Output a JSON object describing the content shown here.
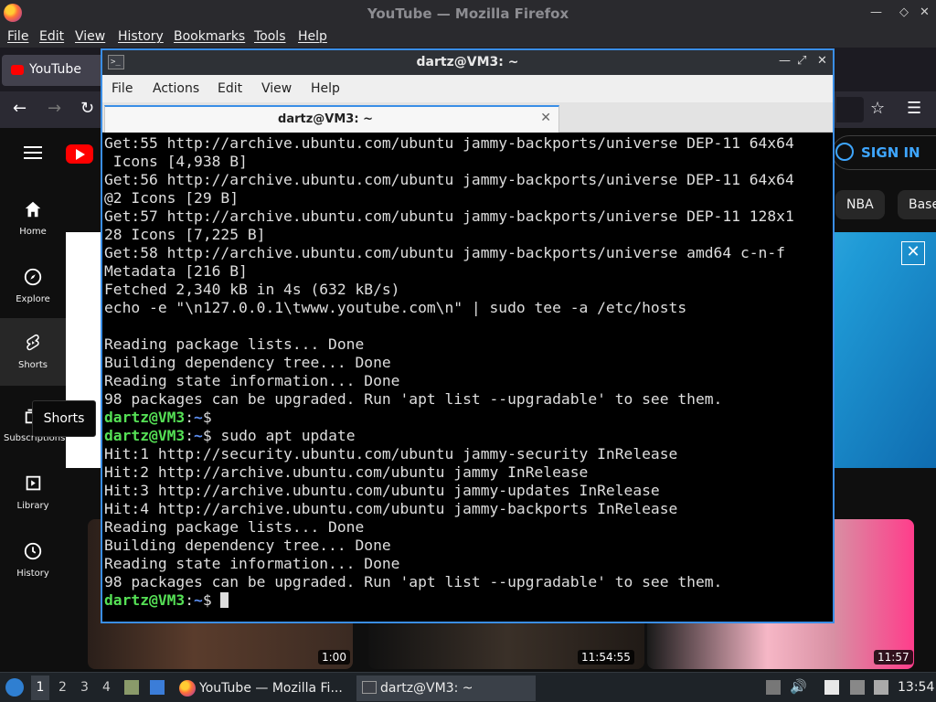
{
  "firefox": {
    "title": "YouTube — Mozilla Firefox",
    "menu": [
      "File",
      "Edit",
      "View",
      "History",
      "Bookmarks",
      "Tools",
      "Help"
    ],
    "tab_label": "YouTube"
  },
  "youtube": {
    "sidebar": [
      {
        "label": "Home",
        "icon": "home-icon"
      },
      {
        "label": "Explore",
        "icon": "compass-icon"
      },
      {
        "label": "Shorts",
        "icon": "shorts-icon"
      },
      {
        "label": "Subscriptions",
        "icon": "subscriptions-icon"
      },
      {
        "label": "Library",
        "icon": "library-icon"
      },
      {
        "label": "History",
        "icon": "history-icon"
      }
    ],
    "tooltip": "Shorts",
    "sign_in": "SIGN IN",
    "chips": [
      "NBA",
      "Base"
    ],
    "banner_close": "✕",
    "durations": [
      "1:00",
      "11:54:55",
      "11:57"
    ]
  },
  "terminal": {
    "window_title": "dartz@VM3: ~",
    "menu": [
      "File",
      "Actions",
      "Edit",
      "View",
      "Help"
    ],
    "tab_title": "dartz@VM3: ~",
    "lines": [
      {
        "text": "Get:55 http://archive.ubuntu.com/ubuntu jammy-backports/universe DEP-11 64x64"
      },
      {
        "text": " Icons [4,938 B]"
      },
      {
        "text": "Get:56 http://archive.ubuntu.com/ubuntu jammy-backports/universe DEP-11 64x64"
      },
      {
        "text": "@2 Icons [29 B]"
      },
      {
        "text": "Get:57 http://archive.ubuntu.com/ubuntu jammy-backports/universe DEP-11 128x1"
      },
      {
        "text": "28 Icons [7,225 B]"
      },
      {
        "text": "Get:58 http://archive.ubuntu.com/ubuntu jammy-backports/universe amd64 c-n-f"
      },
      {
        "text": "Metadata [216 B]"
      },
      {
        "text": "Fetched 2,340 kB in 4s (632 kB/s)"
      },
      {
        "text": "echo -e \"\\n127.0.0.1\\twww.youtube.com\\n\" | sudo tee -a /etc/hosts"
      },
      {
        "text": ""
      },
      {
        "text": "Reading package lists... Done"
      },
      {
        "text": "Building dependency tree... Done"
      },
      {
        "text": "Reading state information... Done"
      },
      {
        "text": "98 packages can be upgraded. Run 'apt list --upgradable' to see them."
      },
      {
        "prompt": true,
        "cmd": ""
      },
      {
        "prompt": true,
        "cmd": " sudo apt update"
      },
      {
        "text": "Hit:1 http://security.ubuntu.com/ubuntu jammy-security InRelease"
      },
      {
        "text": "Hit:2 http://archive.ubuntu.com/ubuntu jammy InRelease"
      },
      {
        "text": "Hit:3 http://archive.ubuntu.com/ubuntu jammy-updates InRelease"
      },
      {
        "text": "Hit:4 http://archive.ubuntu.com/ubuntu jammy-backports InRelease"
      },
      {
        "text": "Reading package lists... Done"
      },
      {
        "text": "Building dependency tree... Done"
      },
      {
        "text": "Reading state information... Done"
      },
      {
        "text": "98 packages can be upgraded. Run 'apt list --upgradable' to see them."
      },
      {
        "prompt": true,
        "cmd": " ",
        "cursor": true
      }
    ],
    "prompt_user": "dartz@VM3",
    "prompt_sep": ":",
    "prompt_path": "~",
    "prompt_end": "$"
  },
  "taskbar": {
    "workspaces": [
      "1",
      "2",
      "3",
      "4"
    ],
    "tasks": [
      "YouTube — Mozilla Fi...",
      "dartz@VM3: ~"
    ],
    "clock": "13:54"
  }
}
